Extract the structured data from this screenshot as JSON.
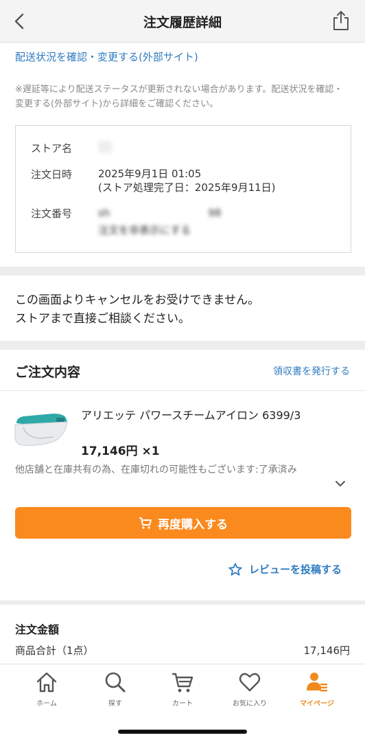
{
  "header": {
    "title": "注文履歴詳細"
  },
  "delivery": {
    "link": "配送状況を確認・変更する(外部サイト)",
    "note": "※遅延等により配送ステータスが更新されない場合があります。配送状況を確認・変更する(外部サイト)から詳細をご確認ください。"
  },
  "store_info": {
    "store_label": "ストア名",
    "store_value": "",
    "date_label": "注文日時",
    "date_value": "2025年9月1日 01:05",
    "processed_value": "(ストア処理完了日：2025年9月11日)",
    "order_no_label": "注文番号",
    "order_no_value": "sh                              98",
    "hide_link": "注文を非表示にする"
  },
  "cancel_message": {
    "line1": "この画面よりキャンセルをお受けできません。",
    "line2": "ストアまで直接ご相談ください。"
  },
  "order": {
    "heading": "ご注文内容",
    "receipt_link": "領収書を発行する",
    "product_name": "アリエッテ パワースチームアイロン 6399/3",
    "product_price": "17,146円 ×1",
    "stock_note": "他店舗と在庫共有の為、在庫切れの可能性もございます:了承済み",
    "rebuy_label": "再度購入する",
    "review_label": "レビューを投稿する"
  },
  "totals": {
    "heading": "注文金額",
    "subtotal_label": "商品合計（1点）",
    "subtotal_value": "17,146円"
  },
  "tabbar": {
    "items": [
      {
        "label": "ホーム",
        "icon": "home-icon"
      },
      {
        "label": "探す",
        "icon": "search-icon"
      },
      {
        "label": "カート",
        "icon": "cart-icon"
      },
      {
        "label": "お気に入り",
        "icon": "heart-icon"
      },
      {
        "label": "マイページ",
        "icon": "mypage-icon",
        "active": true
      }
    ]
  },
  "colors": {
    "accent": "#fb8a1e",
    "link": "#2f7bc0",
    "active_tab": "#f08a1c"
  }
}
